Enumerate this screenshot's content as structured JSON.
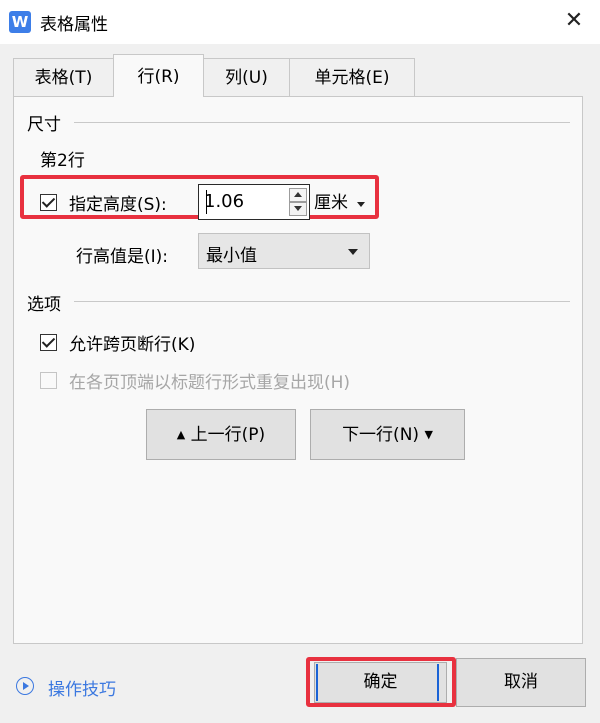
{
  "window": {
    "title": "表格属性",
    "app_icon_letter": "W"
  },
  "tabs": [
    {
      "label": "表格(T)",
      "active": false
    },
    {
      "label": "行(R)",
      "active": true
    },
    {
      "label": "列(U)",
      "active": false
    },
    {
      "label": "单元格(E)",
      "active": false
    }
  ],
  "size_section": {
    "heading": "尺寸",
    "row_label": "第2行",
    "specify_height": {
      "label": "指定高度(S):",
      "checked": true,
      "value": "1.06",
      "unit": "厘米"
    },
    "row_height_is": {
      "label": "行高值是(I):",
      "value": "最小值"
    }
  },
  "options_section": {
    "heading": "选项",
    "allow_break": {
      "label": "允许跨页断行(K)",
      "checked": true
    },
    "repeat_header": {
      "label": "在各页顶端以标题行形式重复出现(H)",
      "checked": false,
      "enabled": false
    }
  },
  "nav": {
    "prev_label": "上一行(P)",
    "next_label": "下一行(N)"
  },
  "footer": {
    "tips_label": "操作技巧",
    "ok_label": "确定",
    "cancel_label": "取消"
  },
  "colors": {
    "highlight": "#e8313f",
    "link": "#3b78e0",
    "focus": "#1a63d6"
  }
}
